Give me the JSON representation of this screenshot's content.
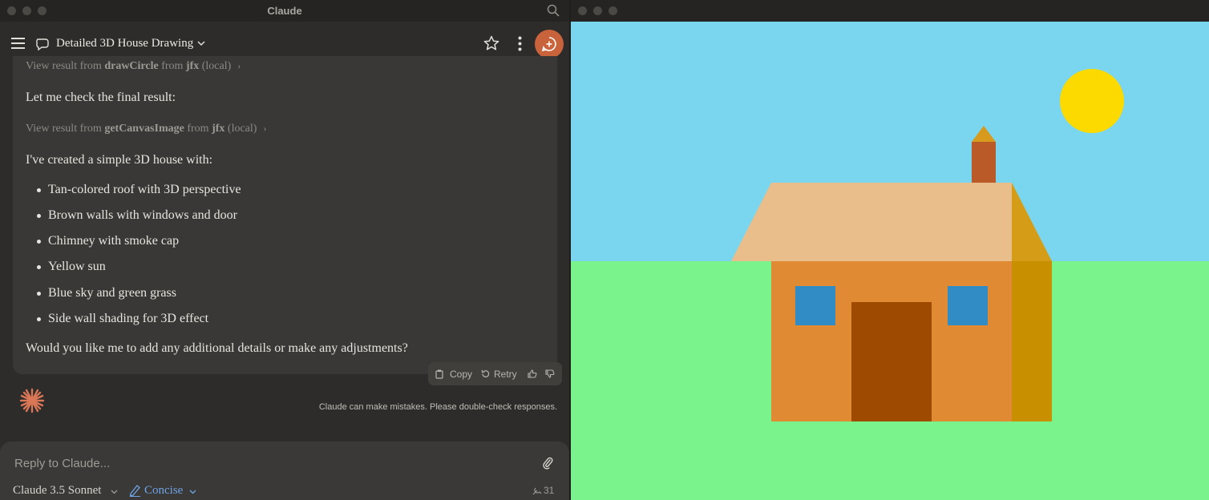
{
  "left_window": {
    "app_title": "Claude",
    "chat_title": "Detailed 3D House Drawing",
    "tool_results": [
      {
        "prefix": "View result from ",
        "tool": "drawCircle",
        "mid": " from ",
        "server": "jfx",
        "suffix": " (local)"
      },
      {
        "prefix": "View result from ",
        "tool": "getCanvasImage",
        "mid": " from ",
        "server": "jfx",
        "suffix": " (local)"
      }
    ],
    "messages": {
      "check": "Let me check the final result:",
      "intro": "I've created a simple 3D house with:",
      "features": [
        "Tan-colored roof with 3D perspective",
        "Brown walls with windows and door",
        "Chimney with smoke cap",
        "Yellow sun",
        "Blue sky and green grass",
        "Side wall shading for 3D effect"
      ],
      "question": "Would you like me to add any additional details or make any adjustments?"
    },
    "actions": {
      "copy": "Copy",
      "retry": "Retry"
    },
    "disclaimer": "Claude can make mistakes. Please double-check responses.",
    "composer": {
      "placeholder": "Reply to Claude...",
      "model": "Claude 3.5 Sonnet",
      "style": "Concise",
      "token_count": "31"
    },
    "icons": [
      "menu-icon",
      "chat-icon",
      "chevron-down-icon",
      "star-icon",
      "more-icon",
      "new-chat-icon",
      "search-icon",
      "copy-icon",
      "retry-icon",
      "thumbs-up-icon",
      "thumbs-down-icon",
      "claude-spark-icon",
      "paperclip-icon",
      "style-pen-icon",
      "tools-icon"
    ]
  },
  "right_window": {
    "scene": {
      "sky_color": "#7ad6ef",
      "grass_color": "#7af38c",
      "sun_color": "#fcda00",
      "roof_color": "#e9be8a",
      "roof_side_color": "#d49c17",
      "wall_color": "#e08b33",
      "side_wall_color": "#c88f00",
      "door_color": "#9e4a00",
      "window_color": "#318bc4",
      "chimney_color": "#b95a28",
      "chimney_cap_color": "#d89a1c"
    }
  },
  "colors": {
    "accent": "#c9633c",
    "style_link": "#6ea4e6",
    "panel_bg": "#2d2c2a",
    "bubble_bg": "#393836"
  }
}
